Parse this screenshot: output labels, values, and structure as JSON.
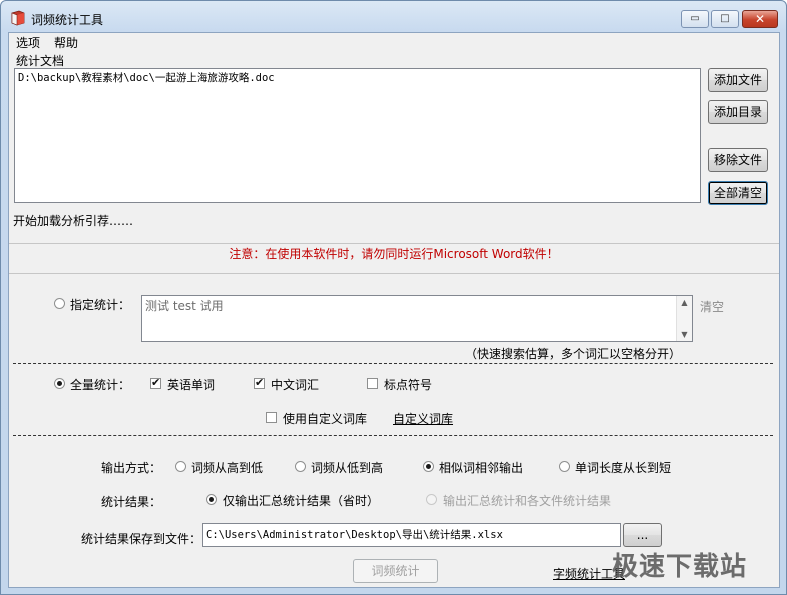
{
  "window": {
    "title": "词频统计工具",
    "min_glyph": "▭",
    "max_glyph": "□",
    "close_glyph": "✕"
  },
  "menu": {
    "items": [
      "选项",
      "帮助"
    ]
  },
  "documents": {
    "group_label": "统计文档",
    "files": [
      "D:\\backup\\教程素材\\doc\\一起游上海旅游攻略.doc"
    ],
    "buttons": {
      "add_file": "添加文件",
      "add_dir": "添加目录",
      "remove_file": "移除文件",
      "clear_all": "全部清空"
    },
    "status": "开始加载分析引荐……"
  },
  "warning": "注意：在使用本软件时，请勿同时运行Microsoft Word软件！",
  "specified": {
    "label": "指定统计：",
    "text": "测试 test 试用",
    "clear_link": "清空",
    "hint": "（快速搜索估算，多个词汇以空格分开）",
    "scroll_up": "▲",
    "scroll_down": "▼"
  },
  "full": {
    "label": "全量统计：",
    "english_words": "英语单词",
    "chinese_words": "中文词汇",
    "punctuation": "标点符号",
    "use_custom_dict": "使用自定义词库",
    "custom_dict_link": "自定义词库"
  },
  "output": {
    "mode_label": "输出方式：",
    "mode_high_low": "词频从高到低",
    "mode_low_high": "词频从低到高",
    "mode_similar": "相似词相邻输出",
    "mode_length": "单词长度从长到短",
    "result_label": "统计结果：",
    "result_summary_only": "仅输出汇总统计结果（省时）",
    "result_summary_each": "输出汇总统计和各文件统计结果",
    "save_label": "统计结果保存到文件：",
    "save_path": "C:\\Users\\Administrator\\Desktop\\导出\\统计结果.xlsx",
    "browse_button": "...",
    "run_button": "词频统计",
    "char_tool_link": "字频统计工具"
  },
  "watermark": "极速下载站"
}
